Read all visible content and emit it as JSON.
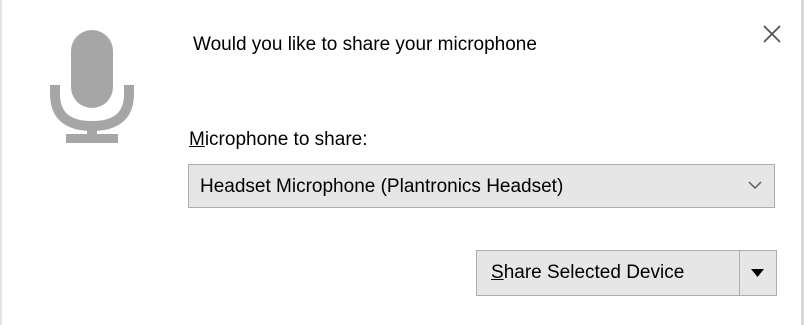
{
  "dialog": {
    "prompt": "Would you like to share your microphone",
    "icon": "microphone-icon",
    "close_icon": "close-icon"
  },
  "device_select": {
    "label_access_key": "M",
    "label_rest": "icrophone to share:",
    "selected_value": "Headset Microphone (Plantronics Headset)",
    "chevron_icon": "chevron-down-icon"
  },
  "actions": {
    "share_access_key": "S",
    "share_rest": "hare Selected Device",
    "menu_icon": "dropdown-arrow-icon"
  },
  "colors": {
    "icon_gray": "#a6a6a6",
    "control_bg": "#e6e6e6",
    "control_border": "#adadad"
  }
}
